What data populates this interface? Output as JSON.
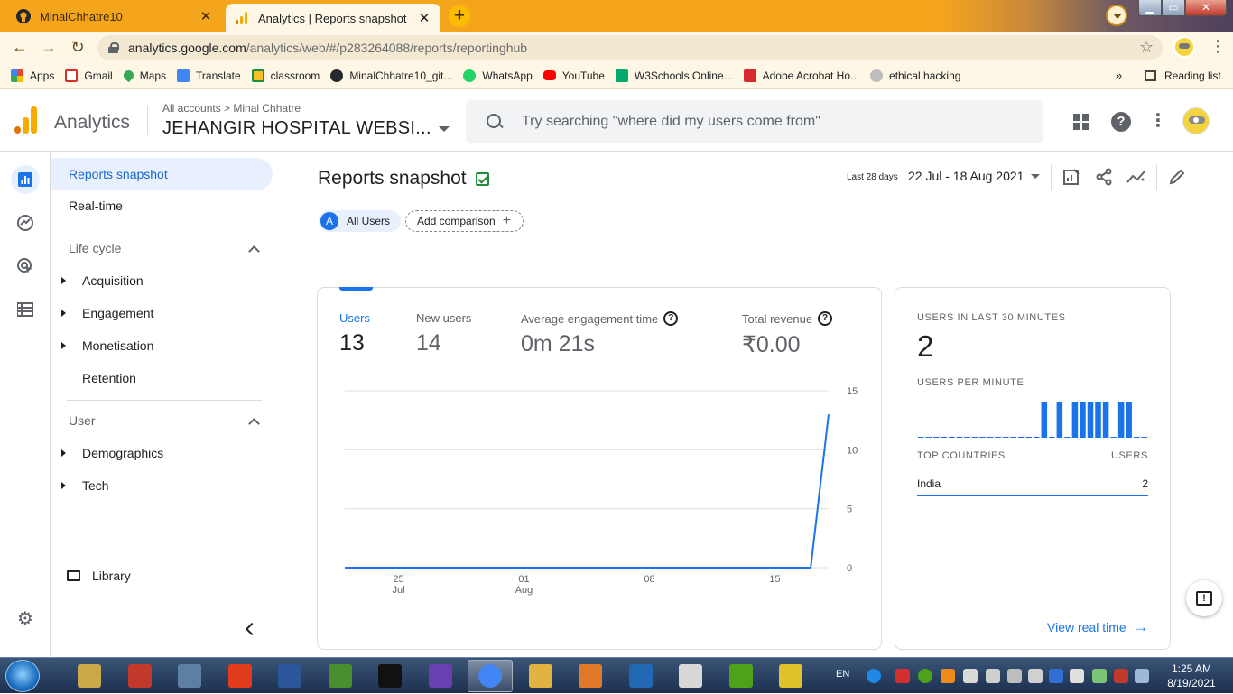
{
  "browser": {
    "tabs": [
      {
        "title": "MinalChhatre10",
        "icon": "github-icon"
      },
      {
        "title": "Analytics | Reports snapshot",
        "icon": "analytics-icon"
      }
    ],
    "url_host": "analytics.google.com",
    "url_path": "/analytics/web/#/p283264088/reports/reportinghub",
    "bookmarks": [
      {
        "label": "Apps",
        "color": "#ea4335"
      },
      {
        "label": "Gmail",
        "color": "#d93025"
      },
      {
        "label": "Maps",
        "color": "#34a853"
      },
      {
        "label": "Translate",
        "color": "#4285f4"
      },
      {
        "label": "classroom",
        "color": "#f6bf26"
      },
      {
        "label": "MinalChhatre10_git...",
        "color": "#24292e"
      },
      {
        "label": "WhatsApp",
        "color": "#25d366"
      },
      {
        "label": "YouTube",
        "color": "#ff0000"
      },
      {
        "label": "W3Schools Online...",
        "color": "#04aa6d"
      },
      {
        "label": "Adobe Acrobat Ho...",
        "color": "#d7282e"
      },
      {
        "label": "ethical hacking",
        "color": "#9aa0a6"
      }
    ],
    "more_bookmarks": "»",
    "reading_list": "Reading list"
  },
  "header": {
    "product": "Analytics",
    "breadcrumb": "All accounts > Minal Chhatre",
    "property": "JEHANGIR HOSPITAL WEBSI...",
    "search_placeholder": "Try searching \"where did my users come from\""
  },
  "nav": {
    "reports_snapshot": "Reports snapshot",
    "realtime": "Real-time",
    "lifecycle": "Life cycle",
    "lifecycle_items": [
      "Acquisition",
      "Engagement",
      "Monetisation",
      "Retention"
    ],
    "user": "User",
    "user_items": [
      "Demographics",
      "Tech"
    ],
    "library": "Library"
  },
  "main": {
    "title": "Reports snapshot",
    "date_label": "Last 28 days",
    "date_range": "22 Jul - 18 Aug 2021",
    "chip_all_avatar": "A",
    "chip_all": "All Users",
    "add_comparison": "Add comparison"
  },
  "metrics": [
    {
      "label": "Users",
      "value": "13"
    },
    {
      "label": "New users",
      "value": "14"
    },
    {
      "label": "Average engagement time",
      "value": "0m 21s"
    },
    {
      "label": "Total revenue",
      "value": "₹0.00"
    }
  ],
  "chart_data": {
    "type": "line",
    "x": [
      "22 Jul",
      "23 Jul",
      "24 Jul",
      "25 Jul",
      "26 Jul",
      "27 Jul",
      "28 Jul",
      "29 Jul",
      "30 Jul",
      "31 Jul",
      "01 Aug",
      "02 Aug",
      "03 Aug",
      "04 Aug",
      "05 Aug",
      "06 Aug",
      "07 Aug",
      "08 Aug",
      "09 Aug",
      "10 Aug",
      "11 Aug",
      "12 Aug",
      "13 Aug",
      "14 Aug",
      "15 Aug",
      "16 Aug",
      "17 Aug",
      "18 Aug"
    ],
    "series": [
      {
        "values": [
          0,
          0,
          0,
          0,
          0,
          0,
          0,
          0,
          0,
          0,
          0,
          0,
          0,
          0,
          0,
          0,
          0,
          0,
          0,
          0,
          0,
          0,
          0,
          0,
          0,
          0,
          0,
          13
        ],
        "color": "#1a73e8"
      }
    ],
    "x_ticks": [
      {
        "date": "25 Jul",
        "day": "25",
        "month": "Jul"
      },
      {
        "date": "01 Aug",
        "day": "01",
        "month": "Aug"
      },
      {
        "date": "08 Aug",
        "day": "08",
        "month": ""
      },
      {
        "date": "15 Aug",
        "day": "15",
        "month": ""
      }
    ],
    "y_ticks": [
      0,
      5,
      10,
      15
    ],
    "ylim": [
      0,
      15
    ],
    "grid": true
  },
  "realtime": {
    "users_label": "USERS IN LAST 30 MINUTES",
    "users_value": "2",
    "per_minute_label": "USERS PER MINUTE",
    "per_minute": [
      0,
      0,
      0,
      0,
      0,
      0,
      0,
      0,
      0,
      0,
      0,
      0,
      0,
      0,
      0,
      0,
      1,
      0,
      1,
      0,
      1,
      1,
      1,
      1,
      1,
      0,
      1,
      1,
      0,
      0
    ],
    "top_countries_label": "TOP COUNTRIES",
    "users_col_label": "USERS",
    "countries": [
      {
        "name": "India",
        "users": "2"
      }
    ],
    "view_link": "View real time"
  },
  "taskbar": {
    "apps": [
      {
        "name": "explorer-libraries",
        "color": "#c9a94a"
      },
      {
        "name": "ms-office-outlook",
        "color": "#c0392b"
      },
      {
        "name": "computer",
        "color": "#5d7fa3"
      },
      {
        "name": "office",
        "color": "#e03c1c"
      },
      {
        "name": "word",
        "color": "#2b579a"
      },
      {
        "name": "project",
        "color": "#4a8f2f"
      },
      {
        "name": "cmd",
        "color": "#111111"
      },
      {
        "name": "visual-studio",
        "color": "#6a3fb0"
      },
      {
        "name": "chrome",
        "color": "#4285f4"
      },
      {
        "name": "file-explorer",
        "color": "#e3b341"
      },
      {
        "name": "eclipse",
        "color": "#e07a2a"
      },
      {
        "name": "r-lang",
        "color": "#2167b3"
      },
      {
        "name": "calendar",
        "color": "#d8d8d8"
      },
      {
        "name": "utorrent",
        "color": "#4ea21a"
      },
      {
        "name": "3d-app",
        "color": "#e0c22a"
      }
    ],
    "lang": "EN",
    "time": "1:25 AM",
    "date": "8/19/2021"
  }
}
